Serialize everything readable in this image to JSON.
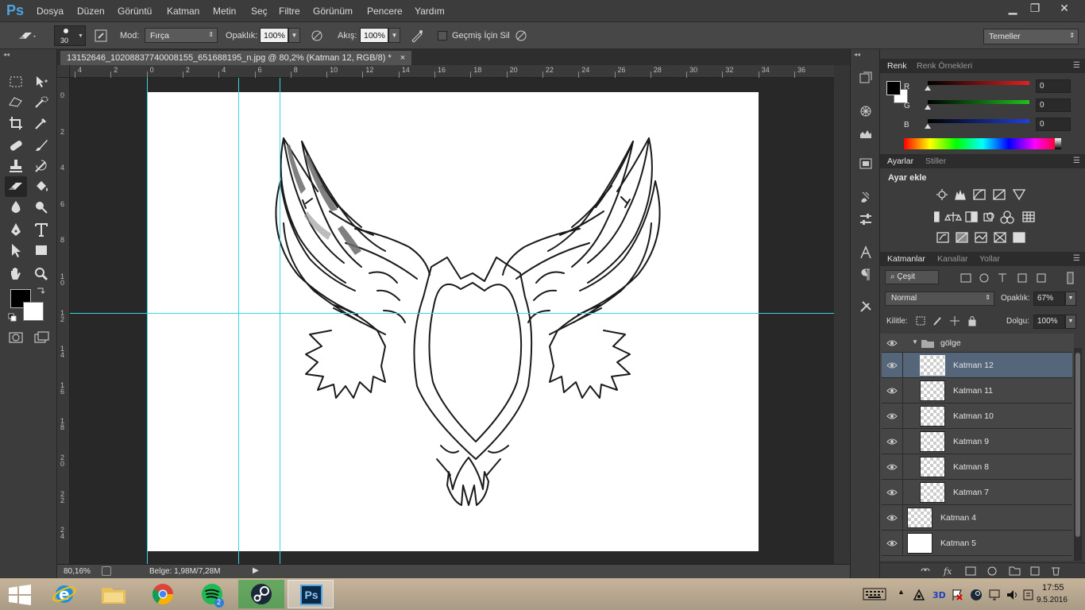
{
  "app": {
    "logo": "Ps",
    "menu": [
      "Dosya",
      "Düzen",
      "Görüntü",
      "Katman",
      "Metin",
      "Seç",
      "Filtre",
      "Görünüm",
      "Pencere",
      "Yardım"
    ],
    "window_controls": {
      "minimize": "▁",
      "restore": "❐",
      "close": "✕"
    }
  },
  "options": {
    "brush_size": "30",
    "mode_label": "Mod:",
    "mode_value": "Fırça",
    "opacity_label": "Opaklık:",
    "opacity_value": "100%",
    "flow_label": "Akış:",
    "flow_value": "100%",
    "erase_history_label": "Geçmiş İçin Sil",
    "workspace": "Temeller"
  },
  "document": {
    "tab_title": "13152646_10208837740008155_651688195_n.jpg @ 80,2% (Katman 12, RGB/8) *",
    "close": "×",
    "ruler_top": [
      "4",
      "2",
      "0",
      "2",
      "4",
      "6",
      "8",
      "10",
      "12",
      "14",
      "16",
      "18",
      "20",
      "22",
      "24",
      "26",
      "28",
      "30",
      "32",
      "34",
      "36"
    ],
    "ruler_left": [
      "0",
      "2",
      "4",
      "6",
      "8",
      "1 0",
      "1 2",
      "1 4",
      "1 6",
      "1 8",
      "2 0",
      "2 2",
      "2 4"
    ],
    "status_zoom": "80,16%",
    "status_doc": "Belge: 1,98M/7,28M"
  },
  "color_panel": {
    "tabs": [
      "Renk",
      "Renk Örnekleri"
    ],
    "channels": [
      {
        "label": "R",
        "value": "0",
        "color": "#e02020"
      },
      {
        "label": "G",
        "value": "0",
        "color": "#20c020"
      },
      {
        "label": "B",
        "value": "0",
        "color": "#2040e0"
      }
    ]
  },
  "adjust_panel": {
    "tabs": [
      "Ayarlar",
      "Stiller"
    ],
    "title": "Ayar ekle"
  },
  "layers_panel": {
    "tabs": [
      "Katmanlar",
      "Kanallar",
      "Yollar"
    ],
    "filter": "Çeşit",
    "blend": "Normal",
    "opacity_label": "Opaklık:",
    "opacity_value": "67%",
    "lock_label": "Kilitle:",
    "fill_label": "Dolgu:",
    "fill_value": "100%",
    "group_name": "gölge",
    "layers": [
      {
        "name": "Katman 12",
        "selected": true,
        "indent": true,
        "white": false
      },
      {
        "name": "Katman 11",
        "selected": false,
        "indent": true,
        "white": false
      },
      {
        "name": "Katman 10",
        "selected": false,
        "indent": true,
        "white": false
      },
      {
        "name": "Katman 9",
        "selected": false,
        "indent": true,
        "white": false
      },
      {
        "name": "Katman 8",
        "selected": false,
        "indent": true,
        "white": false
      },
      {
        "name": "Katman 7",
        "selected": false,
        "indent": true,
        "white": false
      },
      {
        "name": "Katman 4",
        "selected": false,
        "indent": false,
        "white": false
      },
      {
        "name": "Katman 5",
        "selected": false,
        "indent": false,
        "white": true
      }
    ]
  },
  "taskbar": {
    "spotify_badge": "2",
    "clock_time": "17:55",
    "clock_date": "9.5.2016",
    "ps_label": "Ps"
  }
}
